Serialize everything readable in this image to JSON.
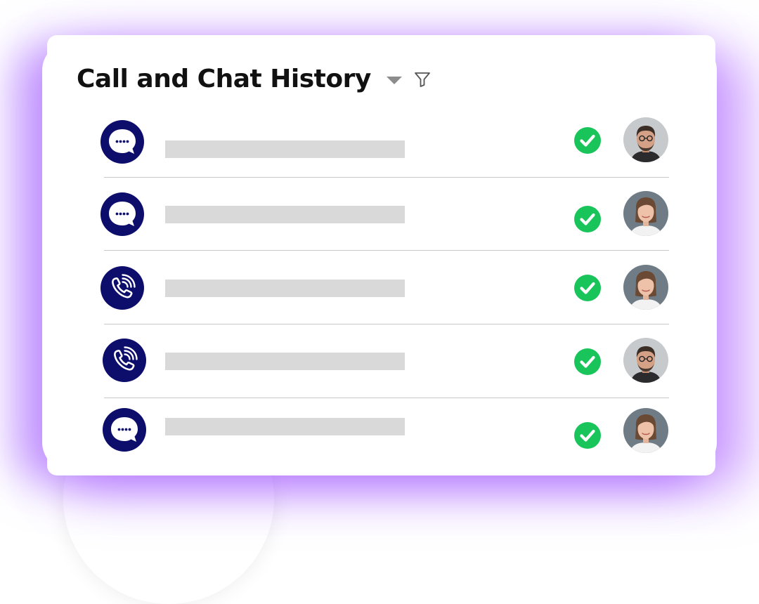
{
  "header": {
    "title": "Call and Chat History",
    "dropdown_icon": "caret-down-icon",
    "filter_icon": "filter-icon"
  },
  "colors": {
    "accent_navy": "#0d0d6b",
    "success_green": "#19c45b",
    "placeholder_gray": "#d9d9d9",
    "glow_purple": "#9a4dff"
  },
  "history": [
    {
      "type": "chat",
      "icon": "chat-bubble-icon",
      "status": "completed",
      "status_icon": "check-circle-icon",
      "avatar": "male-avatar"
    },
    {
      "type": "chat",
      "icon": "chat-bubble-icon",
      "status": "completed",
      "status_icon": "check-circle-icon",
      "avatar": "female-avatar"
    },
    {
      "type": "call",
      "icon": "phone-call-icon",
      "status": "completed",
      "status_icon": "check-circle-icon",
      "avatar": "female-avatar"
    },
    {
      "type": "call",
      "icon": "phone-call-icon",
      "status": "completed",
      "status_icon": "check-circle-icon",
      "avatar": "male-avatar"
    },
    {
      "type": "chat",
      "icon": "chat-bubble-icon",
      "status": "completed",
      "status_icon": "check-circle-icon",
      "avatar": "female-avatar"
    }
  ]
}
